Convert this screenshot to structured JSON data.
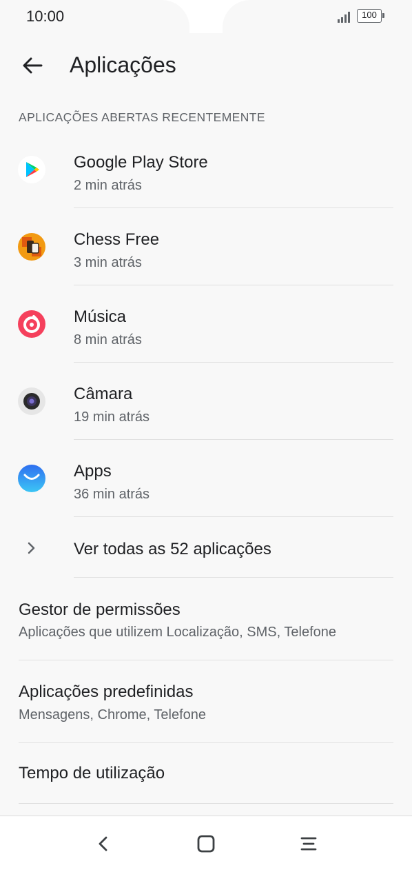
{
  "status_bar": {
    "time": "10:00",
    "battery": "100"
  },
  "header": {
    "title": "Aplicações",
    "back_icon": "arrow-left-icon"
  },
  "recent_section": {
    "header": "APLICAÇÕES ABERTAS RECENTEMENTE",
    "apps": [
      {
        "name": "Google Play Store",
        "time_ago": "2 min atrás",
        "icon": "play-store-icon"
      },
      {
        "name": "Chess Free",
        "time_ago": "3 min atrás",
        "icon": "chess-icon"
      },
      {
        "name": "Música",
        "time_ago": "8 min atrás",
        "icon": "music-icon"
      },
      {
        "name": "Câmara",
        "time_ago": "19 min atrás",
        "icon": "camera-icon"
      },
      {
        "name": "Apps",
        "time_ago": "36 min atrás",
        "icon": "apps-bag-icon"
      }
    ],
    "see_all": "Ver todas as 52 aplicações"
  },
  "settings": [
    {
      "title": "Gestor de permissões",
      "summary": "Aplicações que utilizem Localização, SMS, Telefone"
    },
    {
      "title": "Aplicações predefinidas",
      "summary": "Mensagens, Chrome, Telefone"
    },
    {
      "title": "Tempo de utilização",
      "summary": ""
    }
  ],
  "nav_bar": {
    "back_icon": "nav-back-icon",
    "home_icon": "nav-home-icon",
    "menu_icon": "nav-menu-icon"
  },
  "colors": {
    "background": "#f8f8f8",
    "text_primary": "#202124",
    "text_secondary": "#5f6368",
    "divider": "#e0e0e0"
  }
}
